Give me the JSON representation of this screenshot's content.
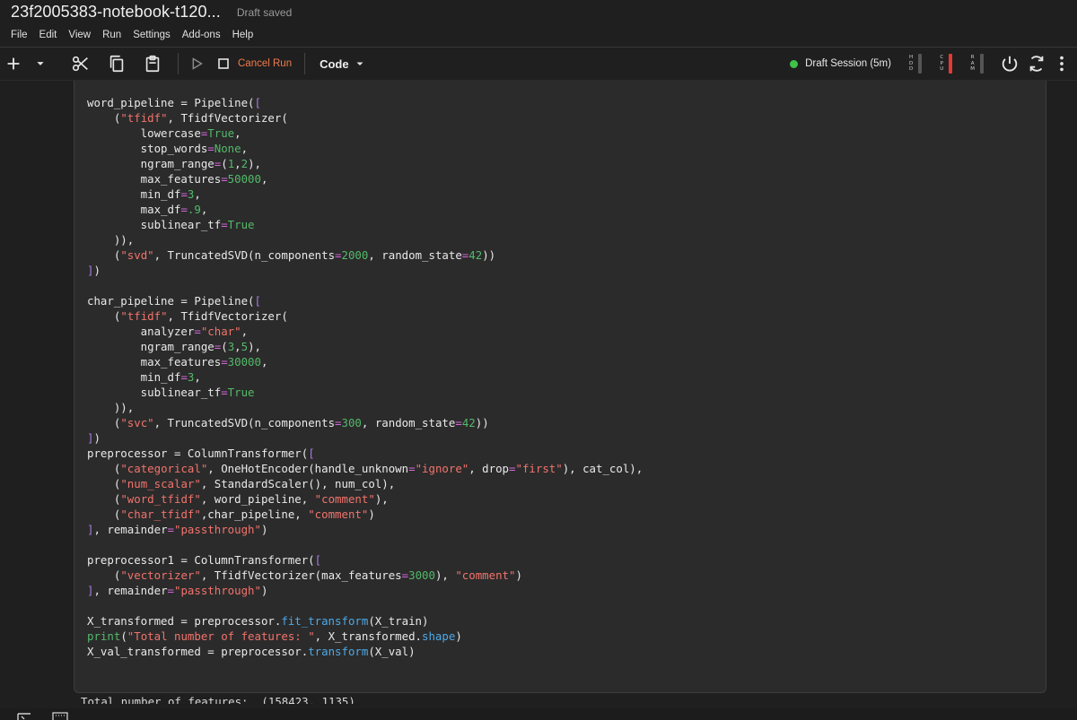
{
  "window": {
    "title": "23f2005383-notebook-t120...",
    "draft_status": "Draft saved"
  },
  "menu": [
    "File",
    "Edit",
    "View",
    "Run",
    "Settings",
    "Add-ons",
    "Help"
  ],
  "toolbar": {
    "cancel_run_label": "Cancel Run",
    "cell_type_label": "Code",
    "session_label": "Draft Session (5m)",
    "session_status_color": "#3fc14a",
    "meters": [
      {
        "letters": [
          "H",
          "D",
          "D"
        ],
        "level": 0.0,
        "color": "#d0d0d0"
      },
      {
        "letters": [
          "C",
          "P",
          "U"
        ],
        "level": 1.0,
        "color": "#e53935"
      },
      {
        "letters": [
          "R",
          "A",
          "M"
        ],
        "level": 0.0,
        "color": "#d0d0d0"
      }
    ],
    "icons": [
      "add-icon",
      "chevron-down-icon",
      "cut-icon",
      "copy-icon",
      "paste-icon",
      "run-icon",
      "stop-icon",
      "chevron-down-icon",
      "power-icon",
      "refresh-icon",
      "more-vert-icon"
    ]
  },
  "cell": {
    "lines": [
      [
        [
          "word_pipeline = Pipeline(",
          ""
        ],
        [
          "[",
          "br"
        ]
      ],
      [
        [
          "    (",
          ""
        ],
        [
          "\"tfidf\"",
          "str"
        ],
        [
          ", TfidfVectorizer(",
          ""
        ]
      ],
      [
        [
          "        lowercase",
          ""
        ],
        [
          "=",
          "op"
        ],
        [
          "True",
          "kw"
        ],
        [
          ",",
          ""
        ]
      ],
      [
        [
          "        stop_words",
          ""
        ],
        [
          "=",
          "op"
        ],
        [
          "None",
          "kw"
        ],
        [
          ",",
          ""
        ]
      ],
      [
        [
          "        ngram_range",
          ""
        ],
        [
          "=",
          "op"
        ],
        [
          "(",
          ""
        ],
        [
          "1",
          "num"
        ],
        [
          ",",
          ""
        ],
        [
          "2",
          "num"
        ],
        [
          "),",
          ""
        ]
      ],
      [
        [
          "        max_features",
          ""
        ],
        [
          "=",
          "op"
        ],
        [
          "50000",
          "num"
        ],
        [
          ",",
          ""
        ]
      ],
      [
        [
          "        min_df",
          ""
        ],
        [
          "=",
          "op"
        ],
        [
          "3",
          "num"
        ],
        [
          ",",
          ""
        ]
      ],
      [
        [
          "        max_df",
          ""
        ],
        [
          "=",
          "op"
        ],
        [
          ".9",
          "num"
        ],
        [
          ",",
          ""
        ]
      ],
      [
        [
          "        sublinear_tf",
          ""
        ],
        [
          "=",
          "op"
        ],
        [
          "True",
          "kw"
        ]
      ],
      [
        [
          "    )),",
          ""
        ]
      ],
      [
        [
          "    (",
          ""
        ],
        [
          "\"svd\"",
          "str"
        ],
        [
          ", TruncatedSVD(n_components",
          ""
        ],
        [
          "=",
          "op"
        ],
        [
          "2000",
          "num"
        ],
        [
          ", random_state",
          ""
        ],
        [
          "=",
          "op"
        ],
        [
          "42",
          "num"
        ],
        [
          "))",
          ""
        ]
      ],
      [
        [
          "]",
          "br"
        ],
        [
          ")",
          ""
        ]
      ],
      [
        [
          "",
          ""
        ]
      ],
      [
        [
          "char_pipeline = Pipeline(",
          ""
        ],
        [
          "[",
          "br"
        ]
      ],
      [
        [
          "    (",
          ""
        ],
        [
          "\"tfidf\"",
          "str"
        ],
        [
          ", TfidfVectorizer(",
          ""
        ]
      ],
      [
        [
          "        analyzer",
          ""
        ],
        [
          "=",
          "op"
        ],
        [
          "\"char\"",
          "str"
        ],
        [
          ",",
          ""
        ]
      ],
      [
        [
          "        ngram_range",
          ""
        ],
        [
          "=",
          "op"
        ],
        [
          "(",
          ""
        ],
        [
          "3",
          "num"
        ],
        [
          ",",
          ""
        ],
        [
          "5",
          "num"
        ],
        [
          "),",
          ""
        ]
      ],
      [
        [
          "        max_features",
          ""
        ],
        [
          "=",
          "op"
        ],
        [
          "30000",
          "num"
        ],
        [
          ",",
          ""
        ]
      ],
      [
        [
          "        min_df",
          ""
        ],
        [
          "=",
          "op"
        ],
        [
          "3",
          "num"
        ],
        [
          ",",
          ""
        ]
      ],
      [
        [
          "        sublinear_tf",
          ""
        ],
        [
          "=",
          "op"
        ],
        [
          "True",
          "kw"
        ]
      ],
      [
        [
          "    )),",
          ""
        ]
      ],
      [
        [
          "    (",
          ""
        ],
        [
          "\"svc\"",
          "str"
        ],
        [
          ", TruncatedSVD(n_components",
          ""
        ],
        [
          "=",
          "op"
        ],
        [
          "300",
          "num"
        ],
        [
          ", random_state",
          ""
        ],
        [
          "=",
          "op"
        ],
        [
          "42",
          "num"
        ],
        [
          "))",
          ""
        ]
      ],
      [
        [
          "]",
          "br"
        ],
        [
          ")",
          ""
        ]
      ],
      [
        [
          "preprocessor = ColumnTransformer(",
          ""
        ],
        [
          "[",
          "br"
        ]
      ],
      [
        [
          "    (",
          ""
        ],
        [
          "\"categorical\"",
          "str"
        ],
        [
          ", OneHotEncoder(handle_unknown",
          ""
        ],
        [
          "=",
          "op"
        ],
        [
          "\"ignore\"",
          "str"
        ],
        [
          ", drop",
          ""
        ],
        [
          "=",
          "op"
        ],
        [
          "\"first\"",
          "str"
        ],
        [
          "), cat_col),",
          ""
        ]
      ],
      [
        [
          "    (",
          ""
        ],
        [
          "\"num_scalar\"",
          "str"
        ],
        [
          ", StandardScaler(), num_col),",
          ""
        ]
      ],
      [
        [
          "    (",
          ""
        ],
        [
          "\"word_tfidf\"",
          "str"
        ],
        [
          ", word_pipeline, ",
          ""
        ],
        [
          "\"comment\"",
          "str"
        ],
        [
          "),",
          ""
        ]
      ],
      [
        [
          "    (",
          ""
        ],
        [
          "\"char_tfidf\"",
          "str"
        ],
        [
          ",char_pipeline, ",
          ""
        ],
        [
          "\"comment\"",
          "str"
        ],
        [
          ")",
          ""
        ]
      ],
      [
        [
          "]",
          "br"
        ],
        [
          ", remainder",
          ""
        ],
        [
          "=",
          "op"
        ],
        [
          "\"passthrough\"",
          "str"
        ],
        [
          ")",
          ""
        ]
      ],
      [
        [
          "",
          ""
        ]
      ],
      [
        [
          "preprocessor1 = ColumnTransformer(",
          ""
        ],
        [
          "[",
          "br"
        ]
      ],
      [
        [
          "    (",
          ""
        ],
        [
          "\"vectorizer\"",
          "str"
        ],
        [
          ", TfidfVectorizer(max_features",
          ""
        ],
        [
          "=",
          "op"
        ],
        [
          "3000",
          "num"
        ],
        [
          "), ",
          ""
        ],
        [
          "\"comment\"",
          "str"
        ],
        [
          ")",
          ""
        ]
      ],
      [
        [
          "]",
          "br"
        ],
        [
          ", remainder",
          ""
        ],
        [
          "=",
          "op"
        ],
        [
          "\"passthrough\"",
          "str"
        ],
        [
          ")",
          ""
        ]
      ],
      [
        [
          "",
          ""
        ]
      ],
      [
        [
          "X_transformed = preprocessor.",
          ""
        ],
        [
          "fit_transform",
          "fn"
        ],
        [
          "(X_train)",
          ""
        ]
      ],
      [
        [
          "print",
          "bi"
        ],
        [
          "(",
          ""
        ],
        [
          "\"Total number of features: \"",
          "str"
        ],
        [
          ", X_transformed.",
          ""
        ],
        [
          "shape",
          "fn"
        ],
        [
          ")",
          ""
        ]
      ],
      [
        [
          "X_val_transformed = preprocessor.",
          ""
        ],
        [
          "transform",
          "fn"
        ],
        [
          "(X_val)",
          ""
        ]
      ]
    ]
  },
  "output": {
    "text": "Total number of features:  (158423, 1135)"
  }
}
